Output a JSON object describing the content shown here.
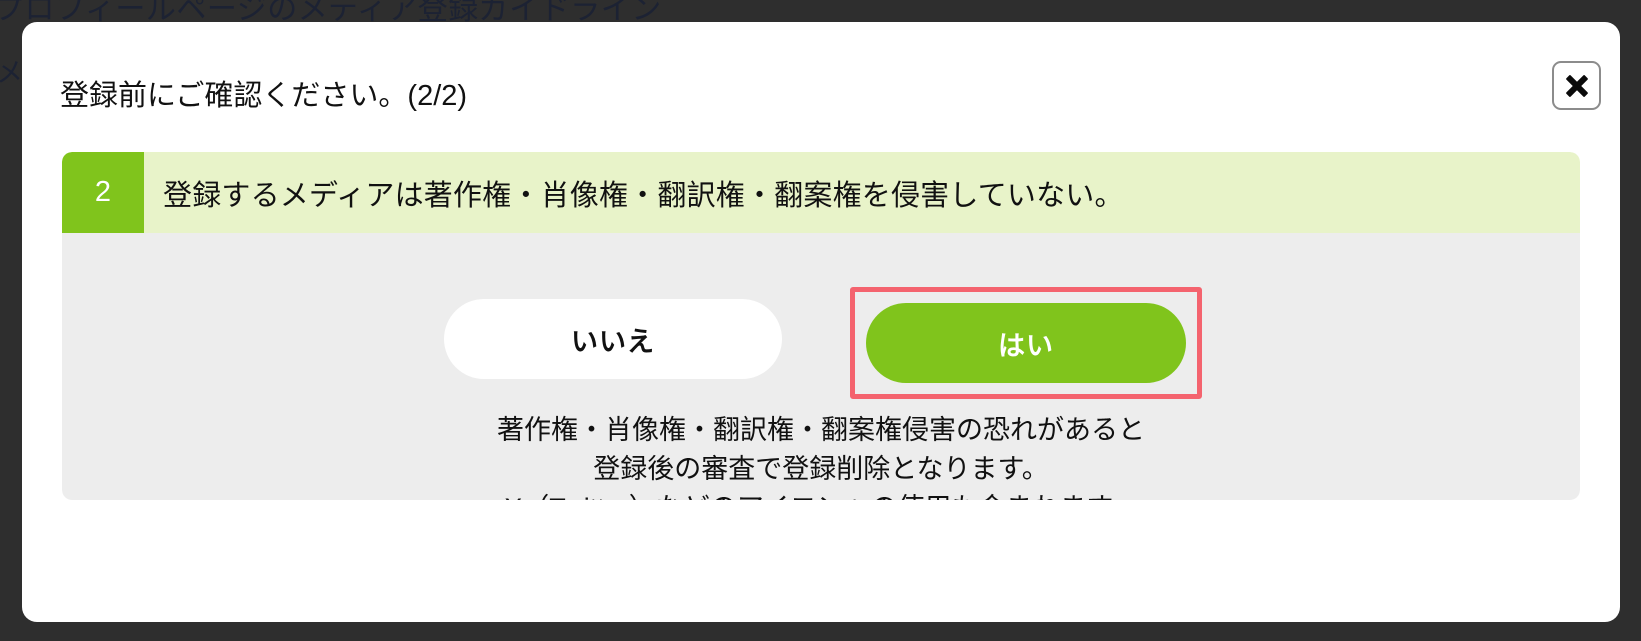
{
  "background": {
    "heading": "プロフィールページのメディア登録ガイドライン",
    "side_text": "メ",
    "overlay_color": "#2e2e2e"
  },
  "modal": {
    "title": "登録前にご確認ください。(2/2)",
    "close_label": "✕",
    "close_icon": "close-icon"
  },
  "question": {
    "number": "2",
    "text": "登録するメディアは著作権・肖像権・翻訳権・翻案権を侵害していない。",
    "badge_color": "#80c41c",
    "bar_color": "#e8f3c9"
  },
  "actions": {
    "no_label": "いいえ",
    "yes_label": "はい",
    "yes_color": "#80c41c",
    "highlight_color": "#f4636e"
  },
  "note": {
    "line1": "著作権・肖像権・翻訳権・翻案権侵害の恐れがあると",
    "line2": "登録後の審査で登録削除となります。",
    "line3": "X（Twitter）などのアイコンへの使用も含まれます。"
  }
}
